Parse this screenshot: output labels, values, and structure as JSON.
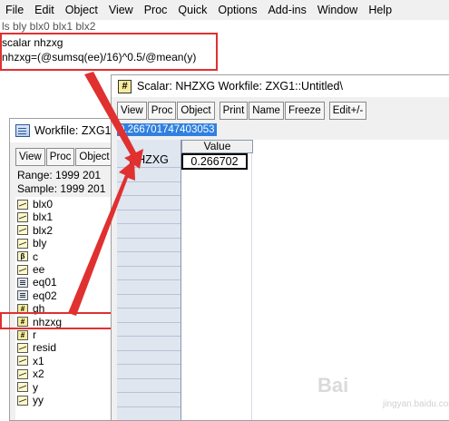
{
  "menubar": [
    "File",
    "Edit",
    "Object",
    "View",
    "Proc",
    "Quick",
    "Options",
    "Add-ins",
    "Window",
    "Help"
  ],
  "command_area": {
    "lines": [
      "ls bly blx0 blx1 blx2",
      "scalar nhzxg",
      "nhzxg=(@sumsq(ee)/16)^0.5/@mean(y)"
    ]
  },
  "workfile_window": {
    "title": "Workfile: ZXG1",
    "toolbar": [
      "View",
      "Proc",
      "Object"
    ],
    "range": "Range:  1999 201",
    "sample": "Sample: 1999 201",
    "objects": [
      {
        "name": "blx0",
        "icon": "series-icon"
      },
      {
        "name": "blx1",
        "icon": "series-icon"
      },
      {
        "name": "blx2",
        "icon": "series-icon"
      },
      {
        "name": "bly",
        "icon": "series-icon"
      },
      {
        "name": "c",
        "icon": "coef-icon"
      },
      {
        "name": "ee",
        "icon": "series-icon"
      },
      {
        "name": "eq01",
        "icon": "equation-icon"
      },
      {
        "name": "eq02",
        "icon": "equation-icon"
      },
      {
        "name": "gh",
        "icon": "scalar-icon"
      },
      {
        "name": "nhzxg",
        "icon": "scalar-icon"
      },
      {
        "name": "r",
        "icon": "scalar-icon"
      },
      {
        "name": "resid",
        "icon": "series-icon"
      },
      {
        "name": "x1",
        "icon": "series-icon"
      },
      {
        "name": "x2",
        "icon": "series-icon"
      },
      {
        "name": "y",
        "icon": "series-icon"
      },
      {
        "name": "yy",
        "icon": "series-icon"
      }
    ]
  },
  "scalar_window": {
    "title": "Scalar: NHZXG   Workfile: ZXG1::Untitled\\",
    "toolbar_group1": [
      "View",
      "Proc",
      "Object"
    ],
    "toolbar_group2": [
      "Print",
      "Name",
      "Freeze"
    ],
    "toolbar_group3": [
      "Edit+/-"
    ],
    "edit_value": "0.266701747403053",
    "column_header": "Value",
    "row_header": "NHZXG",
    "cell_value": "0.266702"
  },
  "watermark": {
    "text": "Bai",
    "sub": "jingyan.baidu.com"
  },
  "colors": {
    "annotation_red": "#e03030",
    "selection_blue": "#3080e0"
  }
}
